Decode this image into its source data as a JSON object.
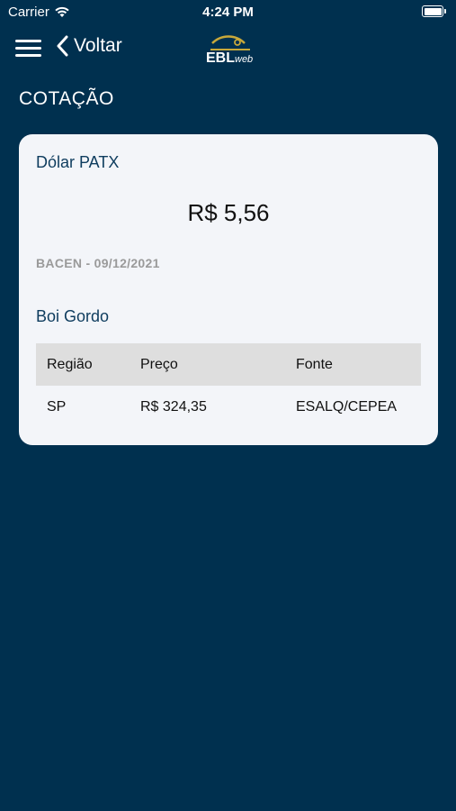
{
  "status": {
    "carrier": "Carrier",
    "time": "4:24 PM"
  },
  "nav": {
    "back_label": "Voltar",
    "logo_text": "EBL",
    "logo_sub": "web"
  },
  "page": {
    "title": "COTAÇÃO"
  },
  "dolar": {
    "title": "Dólar PATX",
    "value": "R$ 5,56",
    "source": "BACEN - 09/12/2021"
  },
  "boi": {
    "title": "Boi Gordo",
    "headers": [
      "Região",
      "Preço",
      "Fonte"
    ],
    "rows": [
      [
        "SP",
        "R$ 324,35",
        "ESALQ/CEPEA"
      ]
    ]
  },
  "colors": {
    "background": "#00304f",
    "card": "#f3f5f9",
    "accent": "#0e3c5e",
    "logo_gold": "#c8a83a"
  }
}
